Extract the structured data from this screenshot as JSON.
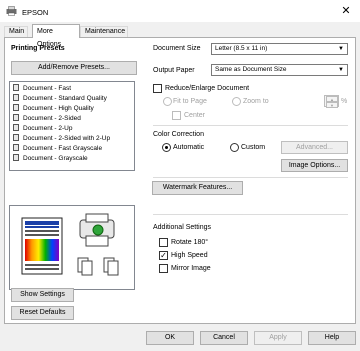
{
  "window": {
    "title": "EPSON",
    "close_glyph": "✕"
  },
  "tabs": [
    {
      "label": "Main",
      "active": false
    },
    {
      "label": "More Options",
      "active": true
    },
    {
      "label": "Maintenance",
      "active": false
    }
  ],
  "presets": {
    "heading": "Printing Presets",
    "add_remove_label": "Add/Remove Presets...",
    "items": [
      "Document - Fast",
      "Document - Standard Quality",
      "Document - High Quality",
      "Document - 2-Sided",
      "Document - 2-Up",
      "Document - 2-Sided with 2-Up",
      "Document - Fast Grayscale",
      "Document - Grayscale"
    ]
  },
  "left_buttons": {
    "show_settings": "Show Settings",
    "reset_defaults": "Reset Defaults"
  },
  "document_size": {
    "label": "Document Size",
    "value": "Letter (8.5 x 11 in)"
  },
  "output_paper": {
    "label": "Output Paper",
    "value": "Same as Document Size"
  },
  "reduce_enlarge": {
    "label": "Reduce/Enlarge Document",
    "checked": false,
    "fit_to_page": "Fit to Page",
    "zoom_to": "Zoom to",
    "center": "Center",
    "zoom_value": "",
    "percent": "%"
  },
  "color_correction": {
    "heading": "Color Correction",
    "automatic": "Automatic",
    "custom": "Custom",
    "selected": "Automatic",
    "advanced_label": "Advanced...",
    "image_options_label": "Image Options..."
  },
  "watermark_label": "Watermark Features...",
  "additional_settings": {
    "heading": "Additional Settings",
    "rotate": {
      "label": "Rotate 180°",
      "checked": false
    },
    "high_speed": {
      "label": "High Speed",
      "checked": true
    },
    "mirror": {
      "label": "Mirror Image",
      "checked": false
    }
  },
  "footer": {
    "ok": "OK",
    "cancel": "Cancel",
    "apply": "Apply",
    "help": "Help"
  },
  "check_glyph": "✓",
  "dropdown_glyph": "▼",
  "spin_up_glyph": "▲",
  "spin_down_glyph": "▼"
}
